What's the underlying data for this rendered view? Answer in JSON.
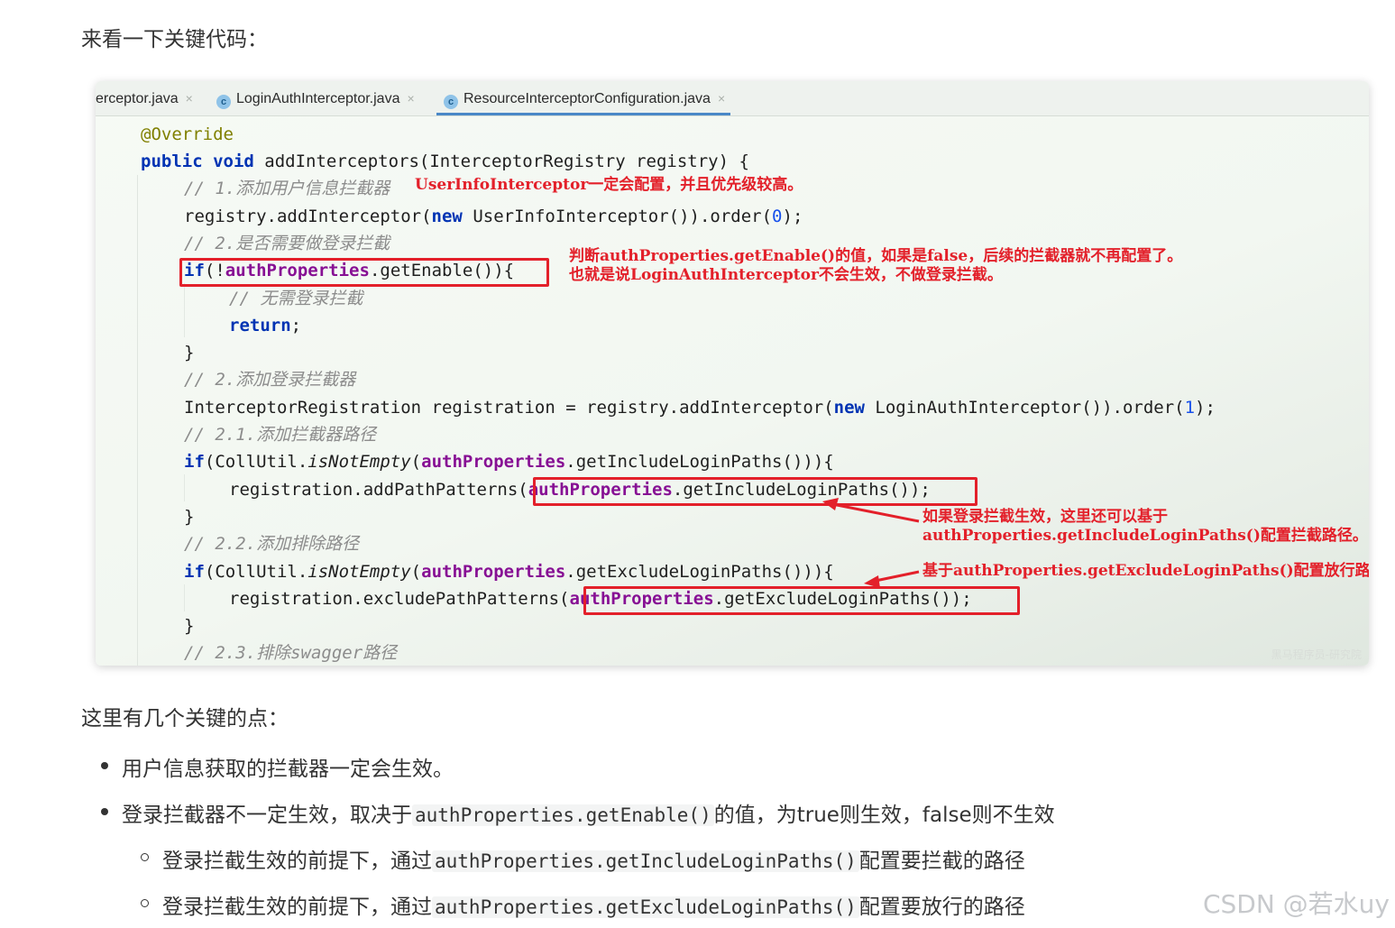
{
  "intro": "来看一下关键代码：",
  "editor": {
    "tabs": [
      {
        "label": "erceptor.java",
        "icon": "",
        "active": false
      },
      {
        "label": "LoginAuthInterceptor.java",
        "icon": "c",
        "active": false
      },
      {
        "label": "ResourceInterceptorConfiguration.java",
        "icon": "c",
        "active": true
      }
    ],
    "tab_close": "×",
    "lines": {
      "l1_ann": "@Override",
      "l2_kw1": "public",
      "l2_kw2": "void",
      "l2_rest": " addInterceptors(InterceptorRegistry registry) {",
      "l3_cmt": "// 1.添加用户信息拦截器",
      "l4_a": "registry.addInterceptor(",
      "l4_kw": "new",
      "l4_b": " UserInfoInterceptor()).order(",
      "l4_num": "0",
      "l4_c": ");",
      "l5_cmt": "// 2.是否需要做登录拦截",
      "l6_kw": "if",
      "l6_a": "(!",
      "l6_fld": "authProperties",
      "l6_b": ".getEnable()){",
      "l7_cmt": "// 无需登录拦截",
      "l8_kw": "return",
      "l8_a": ";",
      "l9": "}",
      "l10_cmt": "// 2.添加登录拦截器",
      "l11_a": "InterceptorRegistration registration = registry.addInterceptor(",
      "l11_kw": "new",
      "l11_b": " LoginAuthInterceptor()).order(",
      "l11_num": "1",
      "l11_c": ");",
      "l12_cmt": "// 2.1.添加拦截器路径",
      "l13_kw": "if",
      "l13_a": "(CollUtil.",
      "l13_it": "isNotEmpty",
      "l13_b": "(",
      "l13_fld": "authProperties",
      "l13_c": ".getIncludeLoginPaths())){",
      "l14_a": "registration.addPathPatterns(",
      "l14_fld": "authProperties",
      "l14_b": ".getIncludeLoginPaths());",
      "l15": "}",
      "l16_cmt": "// 2.2.添加排除路径",
      "l17_kw": "if",
      "l17_a": "(CollUtil.",
      "l17_it": "isNotEmpty",
      "l17_b": "(",
      "l17_fld": "authProperties",
      "l17_c": ".getExcludeLoginPaths())){",
      "l18_a": "registration.excludePathPatterns(",
      "l18_fld": "authProperties",
      "l18_b": ".getExcludeLoginPaths());",
      "l19": "}",
      "l20_cmt": "// 2.3.排除swagger路径"
    },
    "notes": {
      "n1": "UserInfoInterceptor一定会配置，并且优先级较高。",
      "n2": "判断authProperties.getEnable()的值，如果是false，后续的拦截器就不再配置了。\n也就是说LoginAuthInterceptor不会生效，不做登录拦截。",
      "n3": "如果登录拦截生效，这里还可以基于\nauthProperties.getIncludeLoginPaths()配置拦截路径。",
      "n4": "基于authProperties.getExcludeLoginPaths()配置放行路径"
    },
    "watermark": "黑马程序员-研究院",
    "accent_color": "#e3202a"
  },
  "section_title": "这里有几个关键的点：",
  "bullets": {
    "b1": "用户信息获取的拦截器一定会生效。",
    "b2_a": "登录拦截器不一定生效，取决于",
    "b2_code": "authProperties.getEnable()",
    "b2_b": "的值，为true则生效，false则不生效",
    "s1_a": "登录拦截生效的前提下，通过",
    "s1_code": "authProperties.getIncludeLoginPaths()",
    "s1_b": "配置要拦截的路径",
    "s2_a": "登录拦截生效的前提下，通过",
    "s2_code": "authProperties.getExcludeLoginPaths()",
    "s2_b": "配置要放行的路径"
  },
  "csdn_watermark": "CSDN @若水uy"
}
